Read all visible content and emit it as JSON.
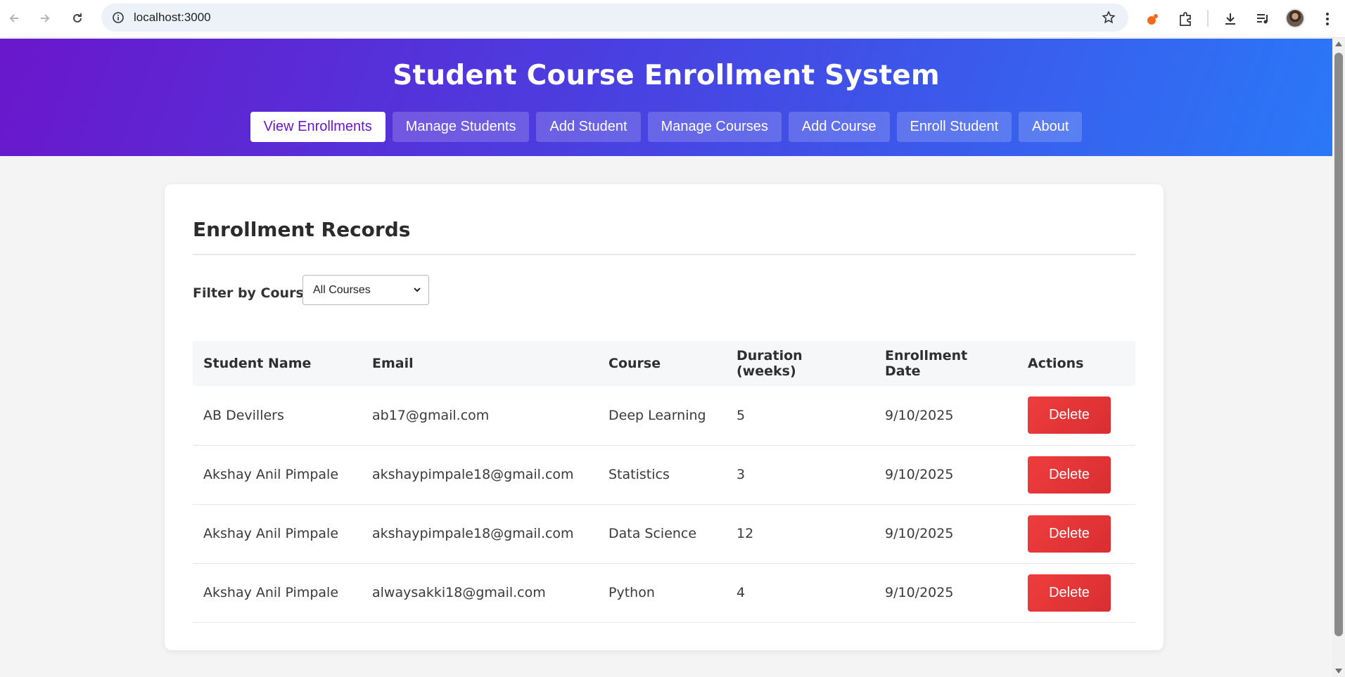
{
  "browser": {
    "url": "localhost:3000"
  },
  "header": {
    "title": "Student Course Enrollment System",
    "tabs": [
      {
        "label": "View Enrollments",
        "active": true
      },
      {
        "label": "Manage Students",
        "active": false
      },
      {
        "label": "Add Student",
        "active": false
      },
      {
        "label": "Manage Courses",
        "active": false
      },
      {
        "label": "Add Course",
        "active": false
      },
      {
        "label": "Enroll Student",
        "active": false
      },
      {
        "label": "About",
        "active": false
      }
    ]
  },
  "records": {
    "title": "Enrollment Records",
    "filter_label": "Filter by Course:",
    "filter_value": "All Courses",
    "columns": [
      "Student Name",
      "Email",
      "Course",
      "Duration (weeks)",
      "Enrollment Date",
      "Actions"
    ],
    "rows": [
      {
        "name": "AB Devillers",
        "email": "ab17@gmail.com",
        "course": "Deep Learning",
        "duration": "5",
        "date": "9/10/2025",
        "action": "Delete"
      },
      {
        "name": "Akshay Anil Pimpale",
        "email": "akshaypimpale18@gmail.com",
        "course": "Statistics",
        "duration": "3",
        "date": "9/10/2025",
        "action": "Delete"
      },
      {
        "name": "Akshay Anil Pimpale",
        "email": "akshaypimpale18@gmail.com",
        "course": "Data Science",
        "duration": "12",
        "date": "9/10/2025",
        "action": "Delete"
      },
      {
        "name": "Akshay Anil Pimpale",
        "email": "alwaysakki18@gmail.com",
        "course": "Python",
        "duration": "4",
        "date": "9/10/2025",
        "action": "Delete"
      }
    ]
  },
  "colors": {
    "header_gradient_start": "#6a17cc",
    "header_gradient_end": "#2a78f8",
    "delete_button": "#e53535"
  }
}
